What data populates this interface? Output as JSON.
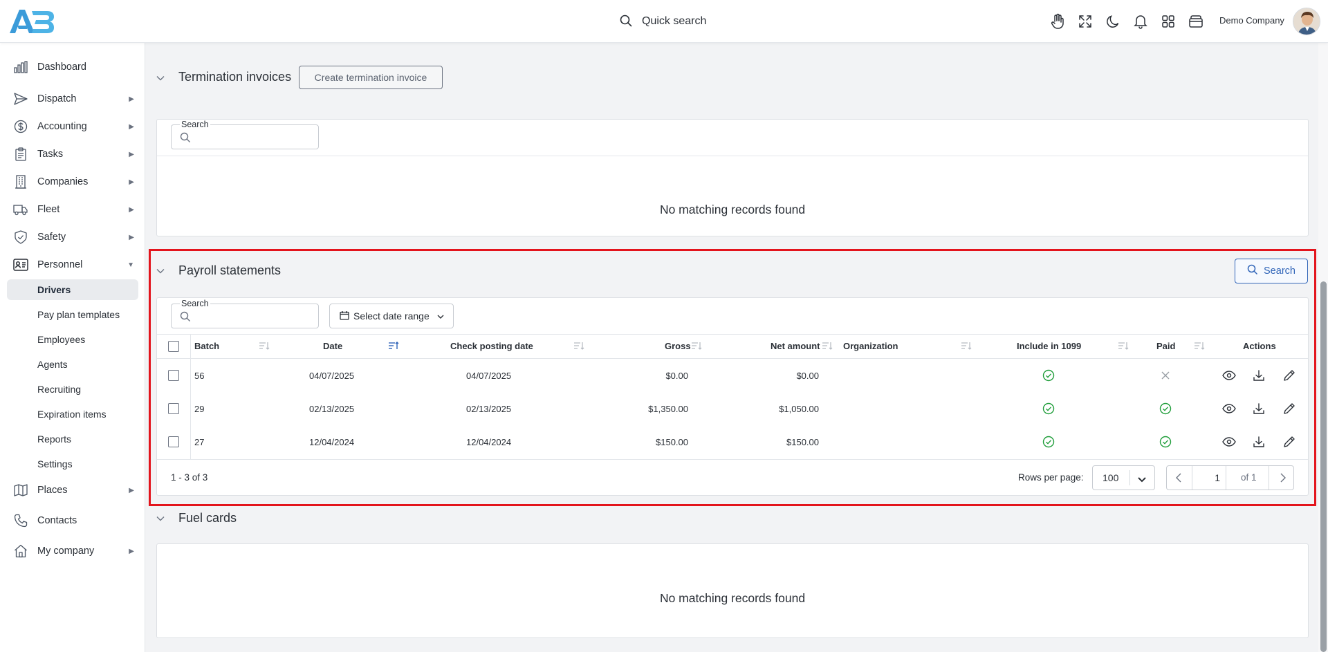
{
  "header": {
    "quick_search_label": "Quick search",
    "company_name": "Demo Company",
    "icons": [
      "hand-icon",
      "fullscreen-icon",
      "moon-icon",
      "bell-icon",
      "apps-grid-icon",
      "wallet-icon"
    ]
  },
  "sidebar": {
    "items": [
      {
        "label": "Dashboard",
        "icon": "bar-chart-icon",
        "arrow": ""
      },
      {
        "label": "Dispatch",
        "icon": "send-icon",
        "arrow": "▶"
      },
      {
        "label": "Accounting",
        "icon": "dollar-icon",
        "arrow": "▶"
      },
      {
        "label": "Tasks",
        "icon": "clipboard-icon",
        "arrow": "▶"
      },
      {
        "label": "Companies",
        "icon": "building-icon",
        "arrow": "▶"
      },
      {
        "label": "Fleet",
        "icon": "truck-icon",
        "arrow": "▶"
      },
      {
        "label": "Safety",
        "icon": "shield-icon",
        "arrow": "▶"
      },
      {
        "label": "Personnel",
        "icon": "id-card-icon",
        "arrow": "▼"
      }
    ],
    "personnel_sub": [
      {
        "label": "Drivers",
        "active": true
      },
      {
        "label": "Pay plan templates"
      },
      {
        "label": "Employees"
      },
      {
        "label": "Agents"
      },
      {
        "label": "Recruiting"
      },
      {
        "label": "Expiration items"
      },
      {
        "label": "Reports"
      },
      {
        "label": "Settings"
      }
    ],
    "bottom_items": [
      {
        "label": "Places",
        "icon": "map-icon",
        "arrow": "▶"
      },
      {
        "label": "Contacts",
        "icon": "phone-icon",
        "arrow": ""
      },
      {
        "label": "My company",
        "icon": "home-icon",
        "arrow": "▶"
      }
    ]
  },
  "termination": {
    "title": "Termination invoices",
    "create_button": "Create termination invoice",
    "search_label": "Search",
    "empty": "No matching records found"
  },
  "payroll": {
    "title": "Payroll statements",
    "search_button": "Search",
    "search_label": "Search",
    "date_range": "Select date range",
    "columns": {
      "batch": "Batch",
      "date": "Date",
      "check_posting_date": "Check posting date",
      "gross": "Gross",
      "net_amount": "Net amount",
      "organization": "Organization",
      "include_1099": "Include in 1099",
      "paid": "Paid",
      "actions": "Actions"
    },
    "rows": [
      {
        "batch": "56",
        "date": "04/07/2025",
        "check_posting_date": "04/07/2025",
        "gross": "$0.00",
        "net_amount": "$0.00",
        "organization": "",
        "include_1099": true,
        "paid": false
      },
      {
        "batch": "29",
        "date": "02/13/2025",
        "check_posting_date": "02/13/2025",
        "gross": "$1,350.00",
        "net_amount": "$1,050.00",
        "organization": "",
        "include_1099": true,
        "paid": true
      },
      {
        "batch": "27",
        "date": "12/04/2024",
        "check_posting_date": "12/04/2024",
        "gross": "$150.00",
        "net_amount": "$150.00",
        "organization": "",
        "include_1099": true,
        "paid": true
      }
    ],
    "footer": {
      "range": "1 - 3 of 3",
      "rows_per_page_label": "Rows per page:",
      "rows_per_page": "100",
      "page": "1",
      "of_pages": "of 1"
    }
  },
  "fuel": {
    "title": "Fuel cards",
    "empty": "No matching records found"
  },
  "colors": {
    "accent": "#2f64b8",
    "success": "#1f9d3a",
    "highlight": "#e3141c"
  }
}
